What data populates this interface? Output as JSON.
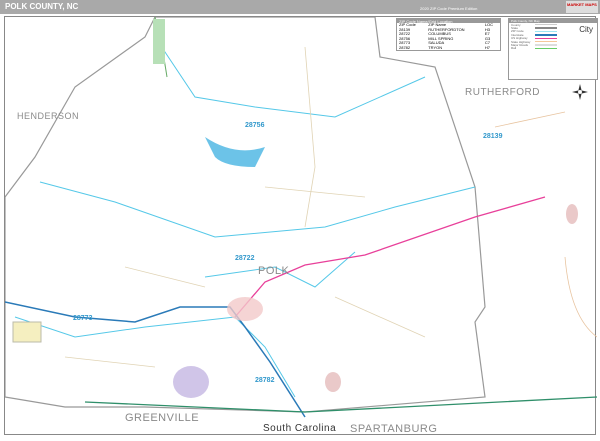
{
  "header": {
    "title": "POLK COUNTY, NC",
    "edition": "2020 ZIP Code Premium Edition",
    "logo": "MARKET MAPS"
  },
  "labels": {
    "henderson": "HENDERSON",
    "rutherford": "RUTHERFORD",
    "polk": "POLK",
    "greenville": "GREENVILLE",
    "south_carolina": "South Carolina",
    "spartanburg": "SPARTANBURG"
  },
  "zips": {
    "z28756": "28756",
    "z28139": "28139",
    "z28722": "28722",
    "z28773": "28773",
    "z28782": "28782"
  },
  "zip_table": {
    "title": "ZIP Code Name/Grid Location",
    "headers": [
      "ZIP Code",
      "ZIP Name",
      "LOC"
    ],
    "rows": [
      [
        "28139",
        "RUTHERFORDTON",
        "H3"
      ],
      [
        "28722",
        "COLUMBUS",
        "E7"
      ],
      [
        "28756",
        "MILL SPRING",
        "G3"
      ],
      [
        "28773",
        "SALUDA",
        "C7"
      ],
      [
        "28782",
        "TRYON",
        "H7"
      ]
    ]
  },
  "legend": {
    "title": "Polk County, NC Map",
    "items": [
      "County",
      "State",
      "ZIP Code",
      "Interstate",
      "US Highway",
      "State Highway",
      "Major Roads",
      "Rail"
    ],
    "city": "City"
  },
  "colors": {
    "zip_line": "#55c8e8",
    "highway": "#e8409a",
    "interstate": "#2a7ab8",
    "state_line": "#2f8f6a"
  }
}
